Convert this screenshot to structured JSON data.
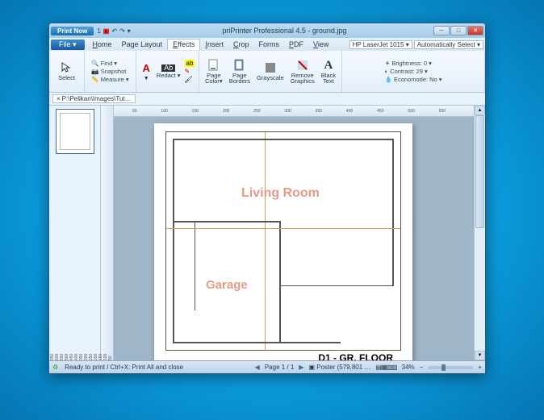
{
  "titlebar": {
    "print_now": "Print Now",
    "qat_page": "1",
    "title": "priPrinter Professional 4.5 - ground.jpg"
  },
  "menu": {
    "file": "File",
    "items": [
      "Home",
      "Page Layout",
      "Effects",
      "Insert",
      "Crop",
      "Forms",
      "PDF",
      "View"
    ],
    "printer": "HP LaserJet 1015",
    "auto_select": "Automatically Select"
  },
  "ribbon": {
    "select": "Select",
    "find": "Find",
    "snapshot": "Snapshot",
    "measure": "Measure",
    "redact": "Redact",
    "page_color": "Page Color",
    "page_borders": "Page Borders",
    "grayscale": "Grayscale",
    "remove_graphics": "Remove Graphics",
    "black_text": "Black Text",
    "brightness_lbl": "Brightness:",
    "brightness_val": "0",
    "contrast_lbl": "Contrast:",
    "contrast_val": "29",
    "economode_lbl": "Economode:",
    "economode_val": "No"
  },
  "document_tab": "P:\\Pelikan\\Images\\Tut…",
  "ruler_h": [
    "50",
    "100",
    "150",
    "200",
    "250",
    "300",
    "350",
    "400",
    "450",
    "500",
    "550"
  ],
  "ruler_v": [
    "50",
    "100",
    "150",
    "200",
    "250",
    "300",
    "350",
    "400",
    "450",
    "500",
    "550",
    "600",
    "650",
    "700"
  ],
  "plan": {
    "living_room": "Living Room",
    "garage": "Garage",
    "floor_label": "D1 - GR. FLOOR"
  },
  "status": {
    "ready": "Ready to print / Ctrl+X: Print All and close",
    "page": "Page 1 / 1",
    "poster": "Poster (579,801 …",
    "zoom": "34%"
  }
}
